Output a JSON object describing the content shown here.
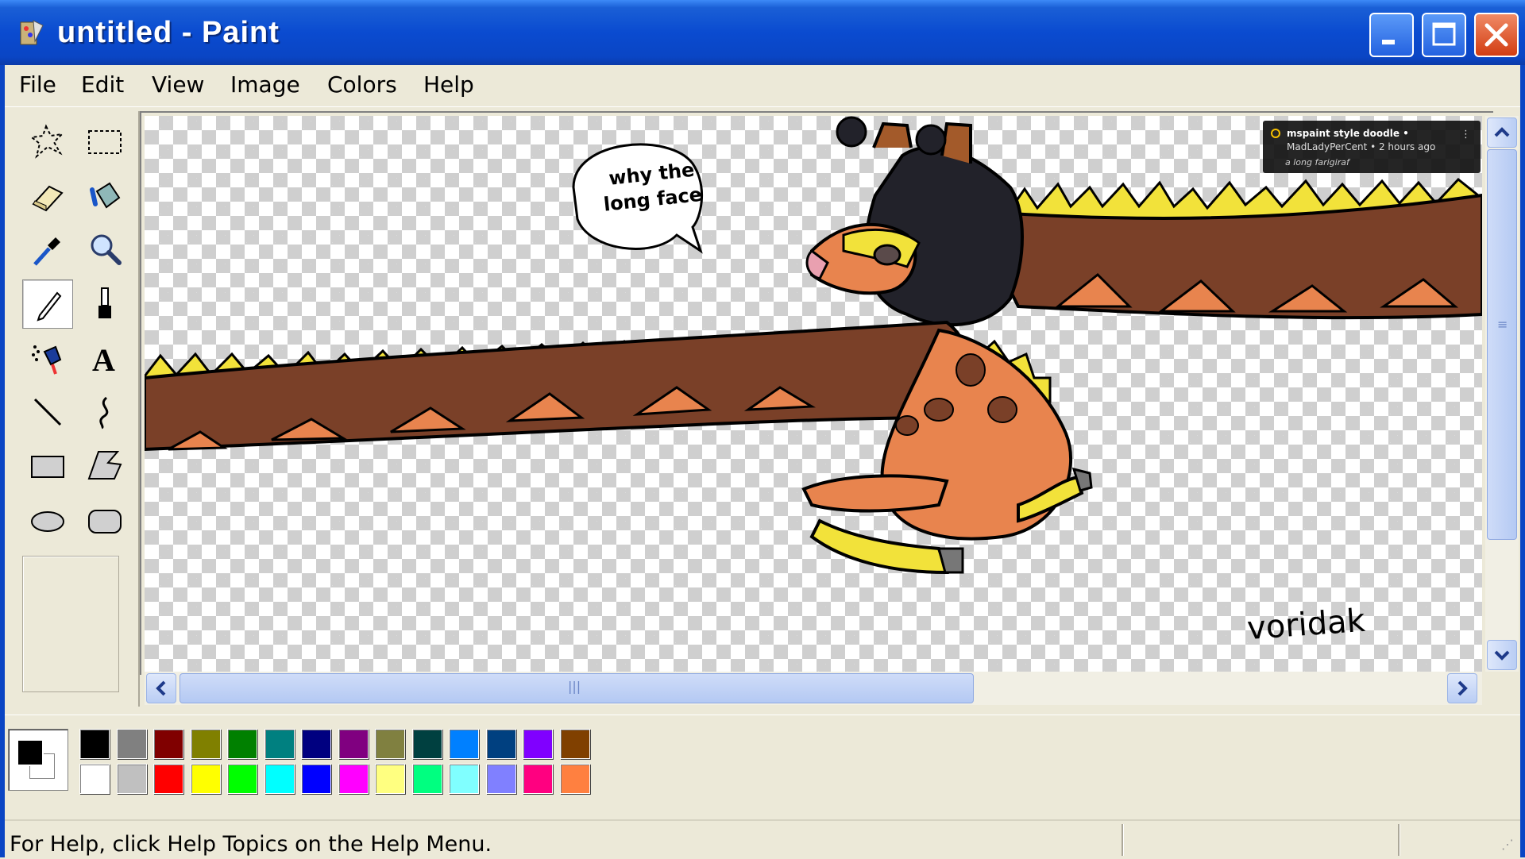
{
  "window": {
    "title": "untitled - Paint",
    "app_icon": "paint-app-icon",
    "controls": [
      "minimize-icon",
      "maximize-icon",
      "close-icon"
    ]
  },
  "menu": [
    {
      "label": "File"
    },
    {
      "label": "Edit"
    },
    {
      "label": "View"
    },
    {
      "label": "Image"
    },
    {
      "label": "Colors"
    },
    {
      "label": "Help"
    }
  ],
  "tools": [
    {
      "name": "free-form-select",
      "icon": "free-select-icon"
    },
    {
      "name": "select",
      "icon": "rect-select-icon"
    },
    {
      "name": "eraser",
      "icon": "eraser-icon"
    },
    {
      "name": "fill-with-color",
      "icon": "paint-bucket-icon"
    },
    {
      "name": "pick-color",
      "icon": "eyedropper-icon"
    },
    {
      "name": "magnifier",
      "icon": "magnifier-icon"
    },
    {
      "name": "pencil",
      "icon": "pencil-icon",
      "selected": true
    },
    {
      "name": "brush",
      "icon": "brush-icon"
    },
    {
      "name": "airbrush",
      "icon": "airbrush-icon"
    },
    {
      "name": "text",
      "icon": "text-icon"
    },
    {
      "name": "line",
      "icon": "line-icon"
    },
    {
      "name": "curve",
      "icon": "curve-icon"
    },
    {
      "name": "rectangle",
      "icon": "rectangle-icon"
    },
    {
      "name": "polygon",
      "icon": "polygon-icon"
    },
    {
      "name": "ellipse",
      "icon": "ellipse-icon"
    },
    {
      "name": "rounded-rectangle",
      "icon": "rounded-rect-icon"
    }
  ],
  "canvas": {
    "speech_bubble": {
      "line1": "why the",
      "line2": "long face"
    },
    "signature": "voridak"
  },
  "video_card": {
    "title": "mspaint style doodle •",
    "meta": "MadLadyPerCent • 2 hours ago",
    "description": "a long farigiraf"
  },
  "palette": {
    "foreground": "#000000",
    "background": "#ffffff",
    "top_row": [
      "#000000",
      "#808080",
      "#800000",
      "#808000",
      "#008000",
      "#008080",
      "#000080",
      "#800080",
      "#808040",
      "#004040",
      "#0080ff",
      "#004080",
      "#8000ff",
      "#804000"
    ],
    "bottom_row": [
      "#ffffff",
      "#c0c0c0",
      "#ff0000",
      "#ffff00",
      "#00ff00",
      "#00ffff",
      "#0000ff",
      "#ff00ff",
      "#ffff80",
      "#00ff80",
      "#80ffff",
      "#8080ff",
      "#ff0080",
      "#ff8040"
    ]
  },
  "status": {
    "text": "For Help, click Help Topics on the Help Menu."
  }
}
